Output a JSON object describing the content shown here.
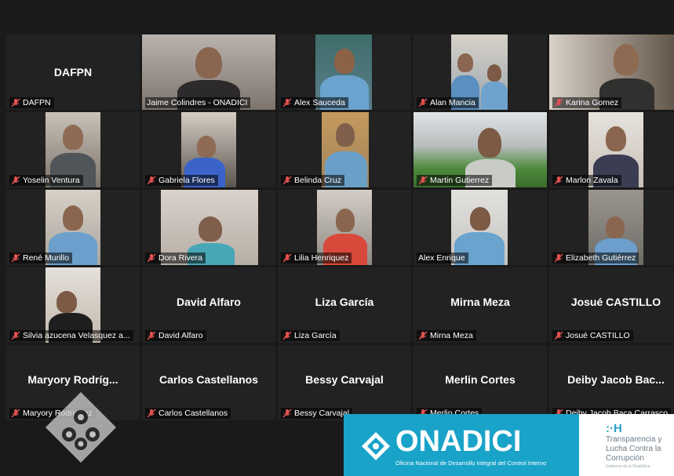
{
  "participants": [
    {
      "name": "DAFPN",
      "display": "DAFPN",
      "video": false
    },
    {
      "name": "Jaime Colindres - ONADICI",
      "video": true,
      "active": true
    },
    {
      "name": "Alex Sauceda",
      "video": true
    },
    {
      "name": "Alan Mancia",
      "video": true
    },
    {
      "name": "Karina Gomez",
      "video": true
    },
    {
      "name": "Yoselin Ventura",
      "video": true
    },
    {
      "name": "Gabriela Flores",
      "video": true
    },
    {
      "name": "Belinda Cruz",
      "video": true
    },
    {
      "name": "Martin Gutierrez",
      "video": true
    },
    {
      "name": "Marlon Zavala",
      "video": true
    },
    {
      "name": "René Murillo",
      "video": true
    },
    {
      "name": "Dora Rivera",
      "video": true
    },
    {
      "name": "Lilia Henriquez",
      "video": true
    },
    {
      "name": "Alex Enrique",
      "video": true
    },
    {
      "name": "Elizabeth Gutiérrez",
      "video": true
    },
    {
      "name": "Silvia azucena Velasquez a...",
      "video": true
    },
    {
      "name": "David Alfaro",
      "display": "David Alfaro",
      "video": false
    },
    {
      "name": "Liza García",
      "display": "Liza García",
      "video": false
    },
    {
      "name": "Mirna Meza",
      "display": "Mirna Meza",
      "video": false
    },
    {
      "name": "Josué CASTILLO",
      "display": "Josué CASTILLO",
      "video": false
    },
    {
      "name": "Maryory Rodriguez",
      "display": "Maryory Rodríg...",
      "video": false
    },
    {
      "name": "Carlos Castellanos",
      "display": "Carlos Castellanos",
      "video": false
    },
    {
      "name": "Bessy Carvajal",
      "display": "Bessy Carvajal",
      "video": false
    },
    {
      "name": "Merlin Cortes",
      "display": "Merlin Cortes",
      "video": false
    },
    {
      "name": "Deiby Jacob Baca Carrasco",
      "display": "Deiby Jacob Bac...",
      "video": false
    }
  ],
  "overlay": {
    "brand": "ONADICI",
    "brand_sub": "Oficina Nacional de Desarrollo Integral del Control Interno",
    "right_mark": ":·H",
    "right_line1": "Transparencia y",
    "right_line2": "Lucha Contra la",
    "right_line3": "Corrupción",
    "right_small": "Gobierno de la República"
  },
  "colors": {
    "active_border": "#c7d13c",
    "muted_mic": "#e25151",
    "brand_bg": "#1aa3c9"
  }
}
